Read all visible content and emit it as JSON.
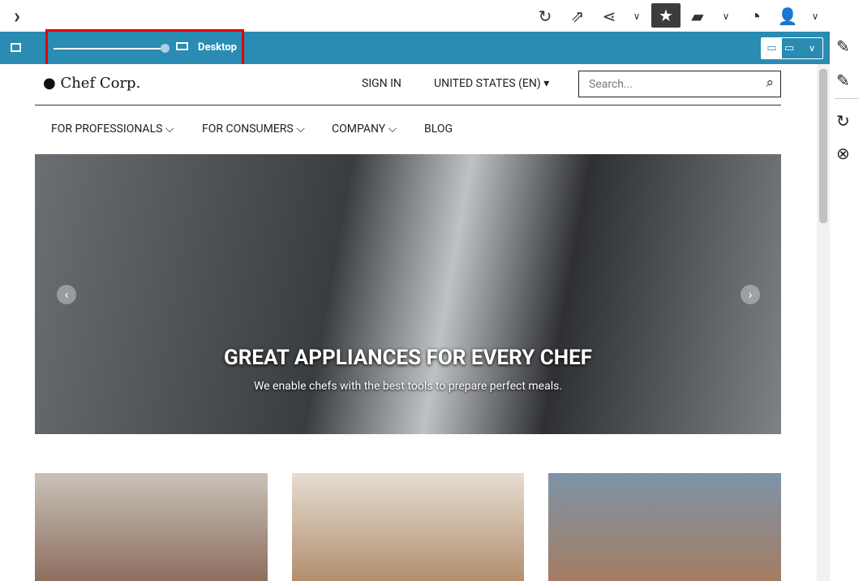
{
  "toolbar": {
    "icons": [
      "chevron-right-icon",
      "reload-icon",
      "open-external-icon",
      "share-icon",
      "chevron-down-icon",
      "star-icon",
      "analytics-icon",
      "chevron-down-icon",
      "clock-icon",
      "user-settings-icon",
      "chevron-down-icon"
    ]
  },
  "preview_bar": {
    "device_label": "Desktop",
    "slider_value": 1.0
  },
  "site": {
    "brand": "Chef Corp.",
    "sign_in": "SIGN IN",
    "locale": "UNITED STATES (EN)",
    "search_placeholder": "Search...",
    "nav": [
      "FOR PROFESSIONALS",
      "FOR CONSUMERS",
      "COMPANY",
      "BLOG"
    ],
    "hero": {
      "title": "GREAT APPLIANCES FOR EVERY CHEF",
      "subtitle": "We enable chefs with the best tools to prepare perfect meals."
    }
  },
  "colors": {
    "accent": "#2a8bb3",
    "highlight": "#e30000"
  }
}
